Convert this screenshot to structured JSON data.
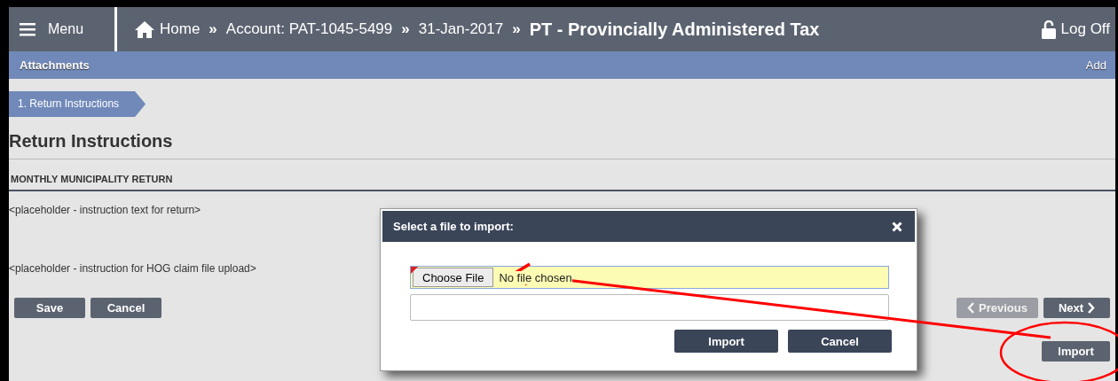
{
  "header": {
    "menu_label": "Menu",
    "breadcrumbs": [
      {
        "kind": "home",
        "text": "Home"
      },
      {
        "kind": "link",
        "text": "Account: PAT-1045-5499"
      },
      {
        "kind": "link",
        "text": "31-Jan-2017"
      },
      {
        "kind": "current",
        "text": "PT - Provincially Administered Tax"
      }
    ],
    "separator": "»",
    "logoff": "Log Off"
  },
  "subbar": {
    "title": "Attachments",
    "action": "Add"
  },
  "steps": [
    {
      "label": "1. Return Instructions",
      "selected": true
    }
  ],
  "heading": "Return Instructions",
  "section_title": "MONTHLY MUNICIPALITY RETURN",
  "instructions": [
    "<placeholder - instruction text for return>",
    "<placeholder - instruction for HOG claim file upload>"
  ],
  "form_buttons": [
    {
      "label": "Save"
    },
    {
      "label": "Cancel"
    }
  ],
  "nav_buttons": [
    {
      "kind": "prev",
      "label": "Previous",
      "disabled": true
    },
    {
      "kind": "next",
      "label": "Next",
      "disabled": false
    }
  ],
  "import_button": "Import",
  "dialog": {
    "title": "Select a file to import:",
    "file_button": "Choose File",
    "file_status": "No file chosen",
    "buttons": [
      {
        "label": "Import"
      },
      {
        "label": "Cancel"
      }
    ]
  }
}
